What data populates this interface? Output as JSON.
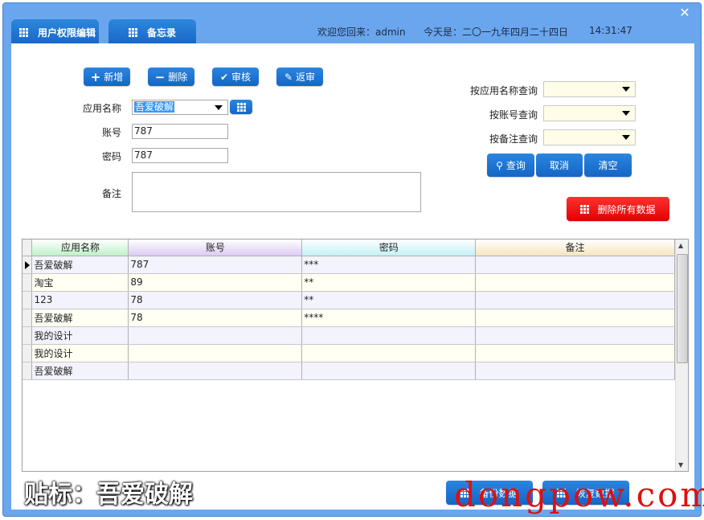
{
  "window": {
    "close_icon": "close-icon"
  },
  "tabs": [
    {
      "label": "用户权限编辑",
      "icon": "grid-icon"
    },
    {
      "label": "备忘录",
      "icon": "grid-icon"
    }
  ],
  "status": {
    "welcome": "欢迎您回来：admin",
    "date": "今天是：二〇一九年四月二十四日",
    "time": "14:31:47"
  },
  "toolbar": {
    "add": "新增",
    "delete": "删除",
    "review": "审核",
    "unreview": "返审"
  },
  "form": {
    "app_name_label": "应用名称",
    "app_name_value": "吾爱破解",
    "account_label": "账号",
    "account_value": "787",
    "password_label": "密码",
    "password_value": "787",
    "note_label": "备注",
    "note_value": ""
  },
  "query": {
    "by_app_label": "按应用名称查询",
    "by_account_label": "按账号查询",
    "by_note_label": "按备注查询",
    "by_app_value": "",
    "by_account_value": "",
    "by_note_value": "",
    "search": "查询",
    "cancel": "取消",
    "clear": "清空",
    "delete_all": "删除所有数据"
  },
  "table": {
    "columns": [
      "应用名称",
      "账号",
      "密码",
      "备注"
    ],
    "column_colors": [
      "#bff0c8",
      "#dccaf4",
      "#c2f1f6",
      "#f7e4c0"
    ],
    "rows": [
      {
        "app": "吾爱破解",
        "account": "787",
        "password": "***",
        "note": "",
        "current": true
      },
      {
        "app": "淘宝",
        "account": "89",
        "password": "**",
        "note": ""
      },
      {
        "app": "123",
        "account": "78",
        "password": "**",
        "note": ""
      },
      {
        "app": "吾爱破解",
        "account": "78",
        "password": "****",
        "note": ""
      },
      {
        "app": "我的设计",
        "account": "",
        "password": "",
        "note": ""
      },
      {
        "app": "我的设计",
        "account": "",
        "password": "",
        "note": ""
      },
      {
        "app": "吾爱破解",
        "account": "",
        "password": "",
        "note": ""
      }
    ]
  },
  "footer": {
    "backup": "备份数据",
    "restore": "恢复数据",
    "watermark_left": "贴标：吾爱破解",
    "watermark_right": "dongpow.com"
  }
}
